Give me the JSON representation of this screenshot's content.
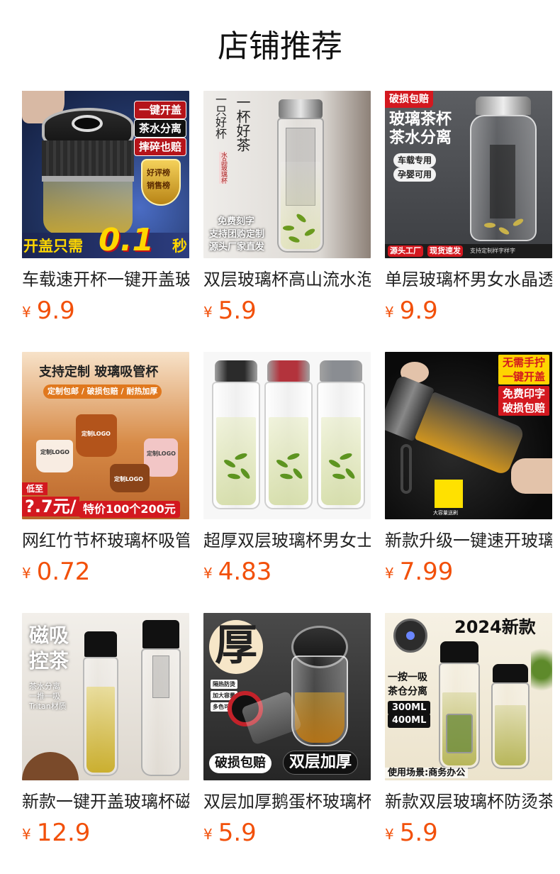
{
  "page": {
    "title": "店铺推荐"
  },
  "products": [
    {
      "name": "车载速开杯一键开盖玻璃杯茶水分离",
      "currency": "¥",
      "price": "9.9",
      "image": {
        "bg": "#2a3c72",
        "tags": [
          "一键开盖",
          "茶水分离",
          "摔碎也赔"
        ],
        "shield": [
          "好评榜",
          "销售榜"
        ],
        "banner_text": "开盖只需",
        "banner_big": "0.1",
        "banner_unit": "秒"
      }
    },
    {
      "name": "双层玻璃杯高山流水泡茶杯",
      "currency": "¥",
      "price": "5.9",
      "image": {
        "bg": "#e9e6e2",
        "calligraphy_1": "一杯好茶",
        "calligraphy_2": "一只好杯",
        "seal": "水品玻璃杯",
        "lines": [
          "免费刻字",
          "支持团购定制",
          "源头厂家直发"
        ]
      }
    },
    {
      "name": "单层玻璃杯男女水晶透明泡茶杯",
      "currency": "¥",
      "price": "9.9",
      "image": {
        "bg": "#45474b",
        "corner_tag": "破损包赔",
        "headline_1": "玻璃茶杯",
        "headline_2": "茶水分离",
        "chips": [
          "车载专用",
          "孕婴可用"
        ],
        "footer_tags": [
          "源头工厂",
          "现货速发"
        ],
        "footer_note": "支持定制样字样字"
      }
    },
    {
      "name": "网红竹节杯玻璃杯吸管杯",
      "currency": "¥",
      "price": "0.72",
      "image": {
        "bg": "#c97a3a",
        "headline": "支持定制  玻璃吸管杯",
        "subline": "定制包邮 / 破损包赔 / 耐热加厚",
        "cup_labels": [
          "定制LOGO",
          "定制LOGO",
          "定制LOGO",
          "定制LOGO"
        ],
        "price_badge_top": "低至",
        "price_badge": "?.7元/",
        "promo": "特价100个200元"
      }
    },
    {
      "name": "超厚双层玻璃杯男女士便携泡茶杯",
      "currency": "¥",
      "price": "4.83",
      "image": {
        "bg": "#f7f7f7",
        "cap_colors": [
          "#2b2b2b",
          "#b3333c",
          "#8a8d92"
        ]
      }
    },
    {
      "name": "新款升级一键速开玻璃杯",
      "currency": "¥",
      "price": "7.99",
      "image": {
        "bg": "#0d0d0d",
        "tag_1": "无需手拧",
        "tag_2": "一键开盖",
        "tag_3": "免费印字",
        "tag_4": "破损包赔",
        "box_label": "大容量送刷"
      }
    },
    {
      "name": "新款一键开盖玻璃杯磁吸控茶",
      "currency": "¥",
      "price": "12.9",
      "image": {
        "bg": "#ece9e4",
        "headline_1": "磁吸",
        "headline_2": "控茶",
        "features": [
          "茶水分离",
          "一推一吸",
          "Tritan材质"
        ]
      }
    },
    {
      "name": "双层加厚鹅蛋杯玻璃杯",
      "currency": "¥",
      "price": "5.9",
      "image": {
        "bg": "#3a3a3a",
        "big_char": "厚",
        "chips": [
          "隔热防烫",
          "加大容量",
          "多色可选"
        ],
        "bottom_left": "破损包赔",
        "bottom_right": "双层加厚"
      }
    },
    {
      "name": "新款双层玻璃杯防烫茶水分离",
      "currency": "¥",
      "price": "5.9",
      "image": {
        "bg": "#f2ecde",
        "headline": "2024新款",
        "feature_1": "一按一吸",
        "feature_2": "茶仓分离",
        "sizes": [
          "300ML",
          "400ML"
        ],
        "footer": "使用场景:商务办公"
      }
    }
  ]
}
